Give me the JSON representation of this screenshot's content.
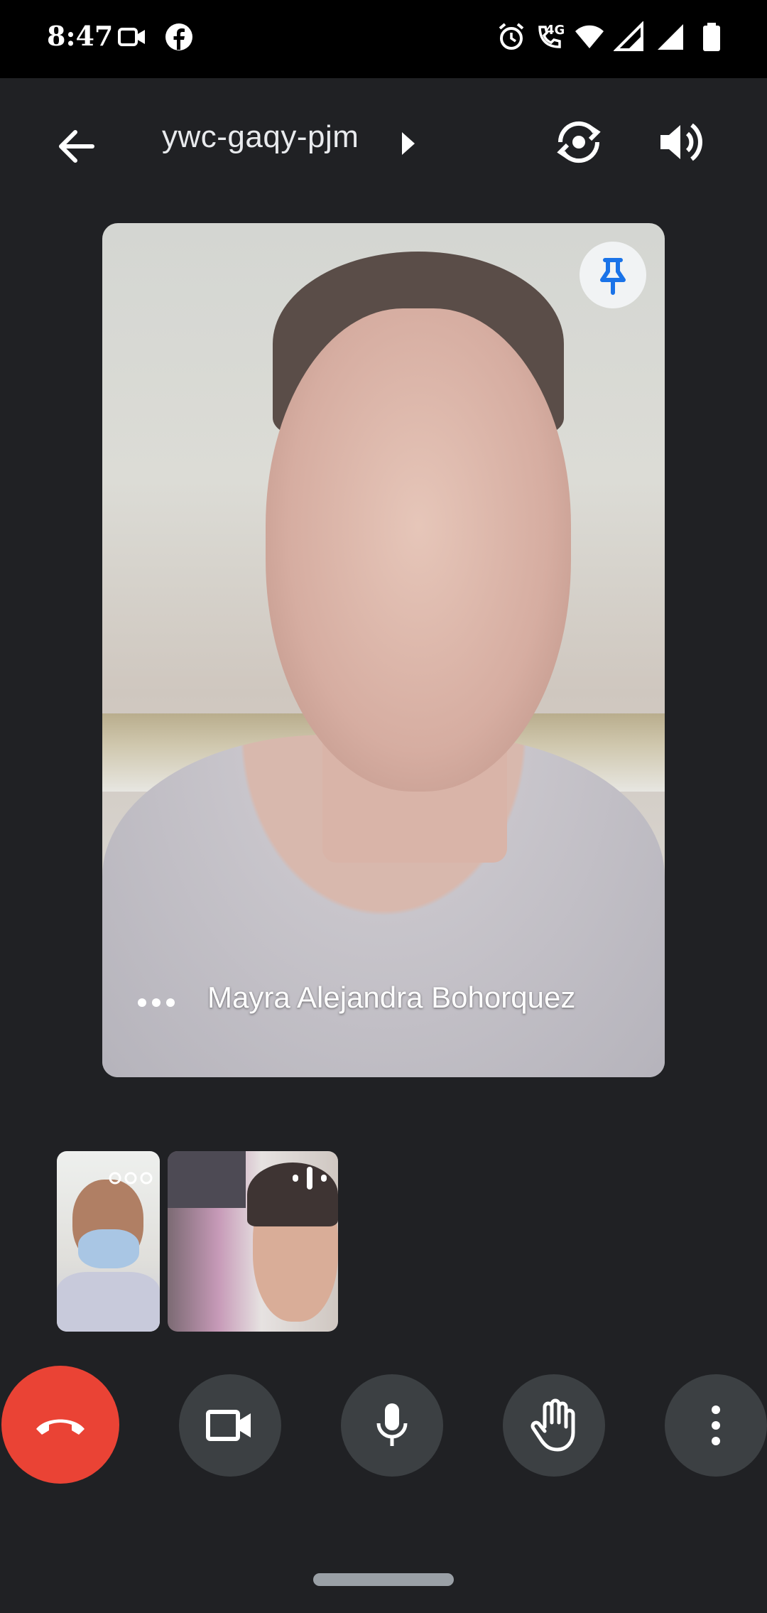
{
  "status_bar": {
    "time": "8:47",
    "left_icons": [
      "video-camera-icon",
      "facebook-icon"
    ],
    "right_icons": [
      "alarm-icon",
      "volte-call-icon",
      "wifi-icon",
      "signal-icon",
      "signal-icon",
      "battery-icon"
    ],
    "network_label": "4G"
  },
  "top_bar": {
    "back_icon": "arrow-left-icon",
    "meeting_code": "ywc-gaqy-pjm",
    "caret_icon": "caret-right-icon",
    "flip_camera_icon": "camera-flip-icon",
    "speaker_icon": "speaker-volume-icon"
  },
  "main_participant": {
    "name": "Mayra Alejandra Bohorquez",
    "pin_icon": "pin-icon",
    "more_icon": "more-horizontal-icon",
    "pin_color": "#1a73e8"
  },
  "thumbnails": [
    {
      "indicator_icon": "speaking-dots-icon"
    },
    {
      "indicator_icon": "audio-level-icon"
    }
  ],
  "controls": [
    {
      "name": "end-call",
      "icon": "phone-hangup-icon",
      "color": "#ea4335"
    },
    {
      "name": "camera",
      "icon": "video-camera-icon"
    },
    {
      "name": "microphone",
      "icon": "microphone-icon"
    },
    {
      "name": "raise-hand",
      "icon": "hand-icon"
    },
    {
      "name": "more-options",
      "icon": "more-vertical-icon"
    }
  ]
}
